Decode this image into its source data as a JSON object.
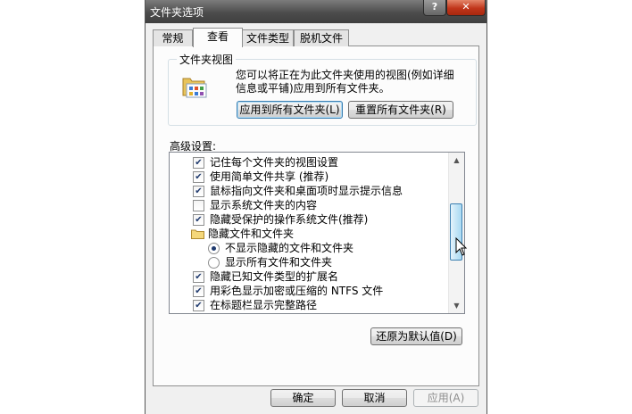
{
  "window": {
    "title": "文件夹选项",
    "help_label": "?",
    "close_label": "✕"
  },
  "tabs": [
    {
      "label": "常规",
      "active": false
    },
    {
      "label": "查看",
      "active": true
    },
    {
      "label": "文件类型",
      "active": false
    },
    {
      "label": "脱机文件",
      "active": false
    }
  ],
  "folder_views": {
    "group_label": "文件夹视图",
    "description": "您可以将正在为此文件夹使用的视图(例如详细信息或平铺)应用到所有文件夹。",
    "apply_all_label": "应用到所有文件夹(L)",
    "reset_all_label": "重置所有文件夹(R)"
  },
  "advanced": {
    "label": "高级设置:",
    "items": [
      {
        "type": "checkbox",
        "checked": true,
        "label": "记住每个文件夹的视图设置"
      },
      {
        "type": "checkbox",
        "checked": true,
        "label": "使用简单文件共享 (推荐)"
      },
      {
        "type": "checkbox",
        "checked": true,
        "label": "鼠标指向文件夹和桌面项时显示提示信息"
      },
      {
        "type": "checkbox",
        "checked": false,
        "label": "显示系统文件夹的内容"
      },
      {
        "type": "checkbox",
        "checked": true,
        "label": "隐藏受保护的操作系统文件(推荐)"
      },
      {
        "type": "folder",
        "label": "隐藏文件和文件夹",
        "icon": "folder-icon"
      },
      {
        "type": "radio",
        "checked": true,
        "label": "不显示隐藏的文件和文件夹"
      },
      {
        "type": "radio",
        "checked": false,
        "label": "显示所有文件和文件夹"
      },
      {
        "type": "checkbox",
        "checked": true,
        "label": "隐藏已知文件类型的扩展名"
      },
      {
        "type": "checkbox",
        "checked": true,
        "label": "用彩色显示加密或压缩的 NTFS 文件"
      },
      {
        "type": "checkbox",
        "checked": true,
        "label": "在标题栏显示完整路径"
      }
    ],
    "restore_defaults_label": "还原为默认值(D)"
  },
  "footer": {
    "ok_label": "确定",
    "cancel_label": "取消",
    "apply_label": "应用(A)"
  }
}
